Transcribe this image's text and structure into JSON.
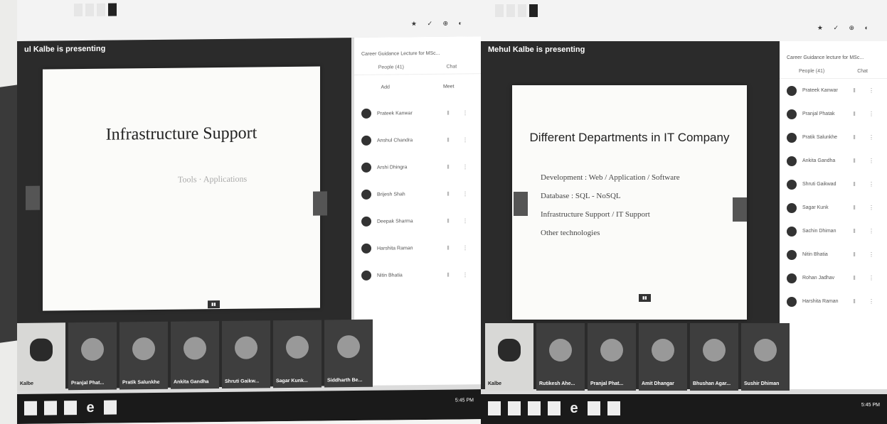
{
  "left": {
    "presenter": "ul Kalbe is presenting",
    "slide_title": "Infrastructure Support",
    "slide_subtitle": "Tools · Applications",
    "panel_title": "Career Guidance Lecture for MSc...",
    "panel_tabs": [
      "People (41)",
      "Chat"
    ],
    "panel_actions": [
      "Add",
      "Meet"
    ],
    "people": [
      "Prateek Kanwar",
      "Anshul Chandra",
      "Arshi Dhingra",
      "Brijesh Shah",
      "Deepak Sharma",
      "Harshita Raman",
      "Nitin Bhatia"
    ],
    "tiles": [
      "Kalbe",
      "Pranjal Phat...",
      "Pratik Salunkhe",
      "Ankita Gandha",
      "Shruti Gaikw...",
      "Sagar Kunk...",
      "Siddharth Be..."
    ]
  },
  "right": {
    "presenter": "Mehul Kalbe is presenting",
    "slide_title": "Different Departments in IT Company",
    "slide_bullets": [
      "Development : Web / Application / Software",
      "Database : SQL - NoSQL",
      "Infrastructure Support / IT Support",
      "Other technologies"
    ],
    "panel_title": "Career Guidance lecture for MSc...",
    "panel_tabs": [
      "People (41)",
      "Chat"
    ],
    "people": [
      "Prateek Kanwar",
      "Pranjal Phatak",
      "Pratik Salunkhe",
      "Ankita Gandha",
      "Shruti Gaikwad",
      "Sagar Kunk",
      "Sachin Dhiman",
      "Nitin Bhatia",
      "Rohan Jadhav",
      "Harshita Raman"
    ],
    "tiles": [
      "Kalbe",
      "Rutikesh Ahe...",
      "Pranjal Phat...",
      "Amit Dhangar",
      "Bhushan Agar...",
      "Sushir Dhiman"
    ]
  },
  "taskbar": {
    "clock_left": "5:45 PM",
    "clock_right": "5:45 PM"
  },
  "icons": [
    "chrome-icon",
    "explorer-icon",
    "meet-icon"
  ]
}
